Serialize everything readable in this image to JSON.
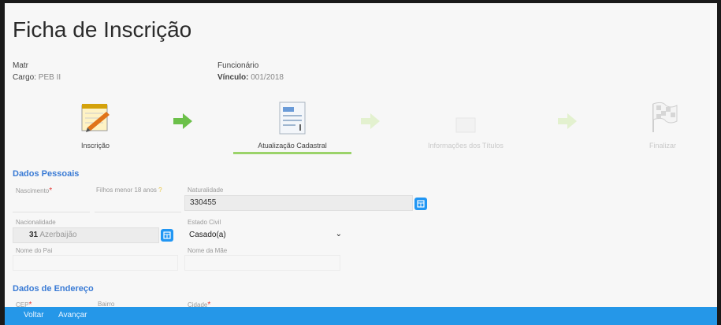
{
  "title": "Ficha de Inscrição",
  "header": {
    "mat_label": "Matr",
    "cargo_label": "Cargo:",
    "cargo_value": "PEB II",
    "funcionario_label": "Funcionário",
    "vinculo_label": "Vínculo:",
    "vinculo_value": "001/2018"
  },
  "steps": [
    {
      "label": "Inscrição",
      "icon": "notepad-pencil-icon"
    },
    {
      "label": "Atualização Cadastral",
      "icon": "form-document-icon"
    },
    {
      "label": "Informações dos Títulos",
      "icon": "documents-icon"
    },
    {
      "label": "Finalizar",
      "icon": "checkered-flag-icon"
    }
  ],
  "sections": {
    "personal": "Dados Pessoais",
    "address": "Dados de Endereço"
  },
  "fields": {
    "nascimento_label": "Nascimento",
    "filhos_label": "Filhos menor 18 anos",
    "naturalidade_label": "Naturalidade",
    "naturalidade_value": "330455",
    "nacionalidade_label": "Nacionalidade",
    "nacionalidade_code": "31",
    "nacionalidade_value": "Azerbaijão",
    "estado_civil_label": "Estado Civil",
    "estado_civil_value": "Casado(a)",
    "nome_pai_label": "Nome do Pai",
    "nome_mae_label": "Nome da Mãe",
    "cep_label": "CEP",
    "bairro_label": "Bairro",
    "cidade_label": "Cidade"
  },
  "footer": {
    "voltar": "Voltar",
    "avancar": "Avançar"
  },
  "colors": {
    "accent": "#2597e8",
    "section": "#3a7bd5",
    "active_step": "#9bd36a",
    "arrow": "#6cc04a"
  }
}
